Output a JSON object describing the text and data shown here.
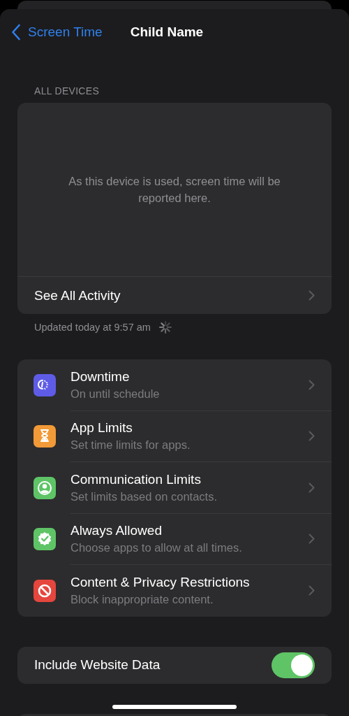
{
  "nav": {
    "back_label": "Screen Time",
    "title": "Child Name"
  },
  "all_devices": {
    "header": "ALL DEVICES",
    "empty_message": "As this device is used, screen time will be reported here.",
    "link": "See All Activity",
    "updated": "Updated today at 9:57 am",
    "loading": true
  },
  "settings": [
    {
      "color": "#5e5ce6",
      "title": "Downtime",
      "subtitle": "On until schedule"
    },
    {
      "color": "#f19a37",
      "title": "App Limits",
      "subtitle": "Set time limits for apps."
    },
    {
      "color": "#5ec466",
      "title": "Communication Limits",
      "subtitle": "Set limits based on contacts."
    },
    {
      "color": "#5ec466",
      "title": "Always Allowed",
      "subtitle": "Choose apps to allow at all times."
    },
    {
      "color": "#e5463d",
      "title": "Content & Privacy Restrictions",
      "subtitle": "Block inappropriate content."
    }
  ],
  "website_data": {
    "label": "Include Website Data",
    "on": true
  }
}
